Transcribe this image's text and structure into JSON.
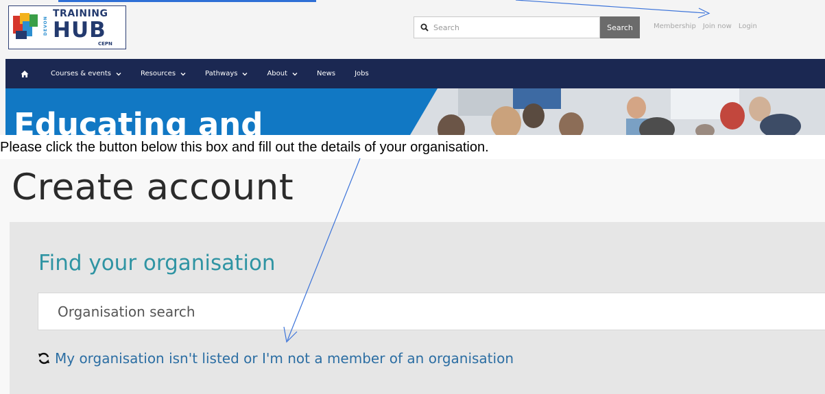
{
  "logo": {
    "training": "TRAINING",
    "hub": "HUB",
    "devon": "DEVON",
    "cepn": "CEPN"
  },
  "header": {
    "search_placeholder": "Search",
    "search_button": "Search",
    "account_links": [
      "Membership",
      "Join now",
      "Login"
    ]
  },
  "nav": {
    "items": [
      {
        "label": "Courses & events",
        "has_dropdown": true
      },
      {
        "label": "Resources",
        "has_dropdown": true
      },
      {
        "label": "Pathways",
        "has_dropdown": true
      },
      {
        "label": "About",
        "has_dropdown": true
      },
      {
        "label": "News",
        "has_dropdown": false
      },
      {
        "label": "Jobs",
        "has_dropdown": false
      }
    ]
  },
  "hero": {
    "heading": "Educating and"
  },
  "instruction": "Please click the button below this box and fill out the details of your organisation.",
  "create_account": {
    "title": "Create account",
    "find_heading": "Find your organisation",
    "search_placeholder": "Organisation search",
    "not_listed_link": "My organisation isn't listed or I'm not a member of an organisation"
  },
  "colors": {
    "nav_bg": "#1b2852",
    "hero_bg": "#1178c4",
    "find_heading": "#2f94a3",
    "link": "#2c6ea3",
    "annotation_arrow": "#3b73d9"
  },
  "icons": [
    "home-icon",
    "search-icon",
    "chevron-down-icon",
    "refresh-icon",
    "arrow-annotation"
  ]
}
